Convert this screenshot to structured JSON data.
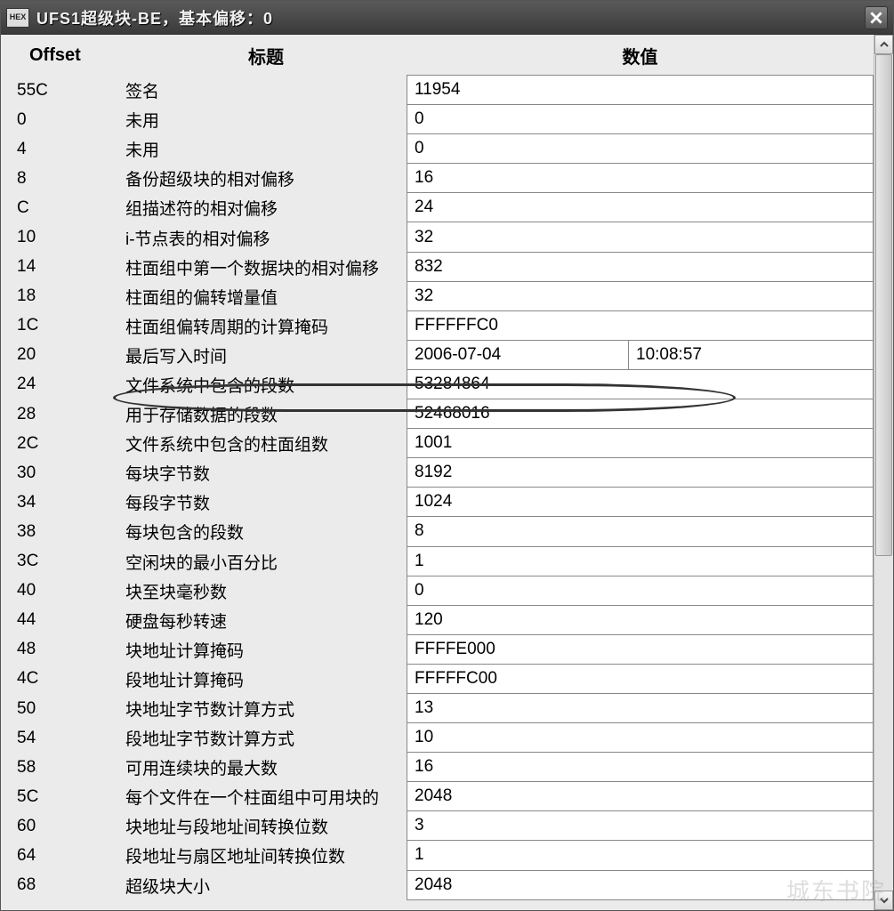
{
  "window": {
    "icon_label": "HEX",
    "title": "UFS1超级块-BE，基本偏移：0"
  },
  "headers": {
    "offset": "Offset",
    "title": "标题",
    "value": "数值"
  },
  "rows": [
    {
      "offset": "55C",
      "title": "签名",
      "value": "11954"
    },
    {
      "offset": "0",
      "title": "未用",
      "value": "0"
    },
    {
      "offset": "4",
      "title": "未用",
      "value": "0"
    },
    {
      "offset": "8",
      "title": "备份超级块的相对偏移",
      "value": "16"
    },
    {
      "offset": "C",
      "title": "组描述符的相对偏移",
      "value": "24"
    },
    {
      "offset": "10",
      "title": "i-节点表的相对偏移",
      "value": "32"
    },
    {
      "offset": "14",
      "title": "柱面组中第一个数据块的相对偏移",
      "value": "832"
    },
    {
      "offset": "18",
      "title": "柱面组的偏转增量值",
      "value": "32"
    },
    {
      "offset": "1C",
      "title": "柱面组偏转周期的计算掩码",
      "value": "FFFFFFC0"
    },
    {
      "offset": "20",
      "title": "最后写入时间",
      "value": "2006-07-04",
      "value2": "10:08:57",
      "highlighted": true
    },
    {
      "offset": "24",
      "title": "文件系统中包含的段数",
      "value": "53284864"
    },
    {
      "offset": "28",
      "title": "用于存储数据的段数",
      "value": "52468016"
    },
    {
      "offset": "2C",
      "title": "文件系统中包含的柱面组数",
      "value": "1001"
    },
    {
      "offset": "30",
      "title": "每块字节数",
      "value": "8192"
    },
    {
      "offset": "34",
      "title": "每段字节数",
      "value": "1024"
    },
    {
      "offset": "38",
      "title": "每块包含的段数",
      "value": "8"
    },
    {
      "offset": "3C",
      "title": "空闲块的最小百分比",
      "value": "1"
    },
    {
      "offset": "40",
      "title": "块至块毫秒数",
      "value": "0"
    },
    {
      "offset": "44",
      "title": "硬盘每秒转速",
      "value": "120"
    },
    {
      "offset": "48",
      "title": "块地址计算掩码",
      "value": "FFFFE000"
    },
    {
      "offset": "4C",
      "title": "段地址计算掩码",
      "value": "FFFFFC00"
    },
    {
      "offset": "50",
      "title": "块地址字节数计算方式",
      "value": "13"
    },
    {
      "offset": "54",
      "title": "段地址字节数计算方式",
      "value": "10"
    },
    {
      "offset": "58",
      "title": "可用连续块的最大数",
      "value": "16"
    },
    {
      "offset": "5C",
      "title": "每个文件在一个柱面组中可用块的",
      "value": "2048"
    },
    {
      "offset": "60",
      "title": "块地址与段地址间转换位数",
      "value": "3"
    },
    {
      "offset": "64",
      "title": "段地址与扇区地址间转换位数",
      "value": "1"
    },
    {
      "offset": "68",
      "title": "超级块大小",
      "value": "2048"
    }
  ],
  "watermark": "城东书院"
}
